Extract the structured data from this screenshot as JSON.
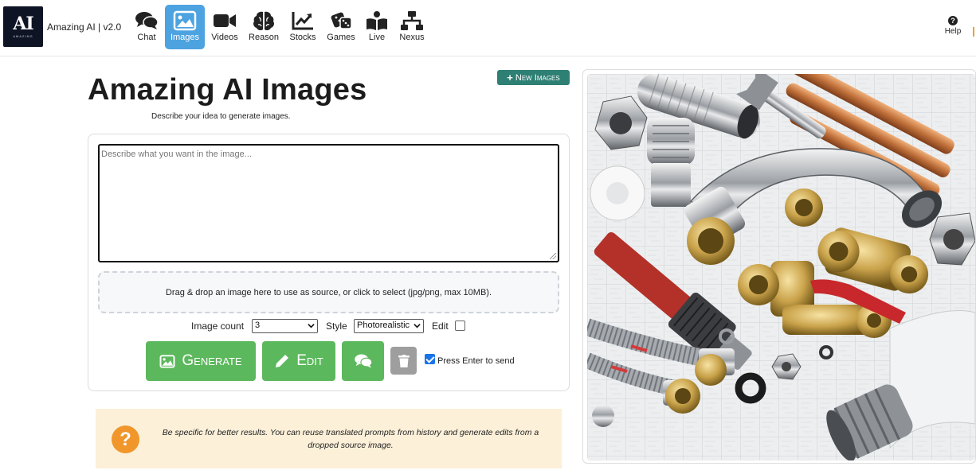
{
  "app": {
    "brand": "Amazing AI | v2.0",
    "logo_text": "AI",
    "logo_word": "AMAZING"
  },
  "nav": {
    "items": [
      {
        "label": "Chat",
        "icon": "chat-icon"
      },
      {
        "label": "Images",
        "icon": "image-icon",
        "active": true
      },
      {
        "label": "Videos",
        "icon": "video-icon"
      },
      {
        "label": "Reason",
        "icon": "brain-icon"
      },
      {
        "label": "Stocks",
        "icon": "chart-line-icon"
      },
      {
        "label": "Games",
        "icon": "dice-icon"
      },
      {
        "label": "Live",
        "icon": "book-reader-icon"
      },
      {
        "label": "Nexus",
        "icon": "network-icon"
      }
    ],
    "help_label": "Help",
    "active_color": "#4da3e0"
  },
  "main": {
    "title": "Amazing AI Images",
    "subtitle": "Describe your idea to generate images.",
    "new_images_label": "New Images",
    "prompt_placeholder": "Describe what you want in the image...",
    "dropzone_text": "Drag & drop an image here to use as source, or click to select (jpg/png, max 10MB).",
    "image_count_label": "Image count",
    "image_count_value": "3",
    "style_label": "Style",
    "style_value": "Photorealistic",
    "edit_label": "Edit",
    "edit_checked": false,
    "generate_label": "Generate",
    "edit_button_label": "Edit",
    "press_enter_label": "Press Enter to send",
    "press_enter_checked": true,
    "button_color": "#5cb85c"
  },
  "tip": {
    "icon": "question-circle-icon",
    "text": "Be specific for better results. You can reuse translated prompts from history and generate edits from a dropped source image."
  },
  "preview": {
    "description_icon": "generated-image-plumbing"
  }
}
